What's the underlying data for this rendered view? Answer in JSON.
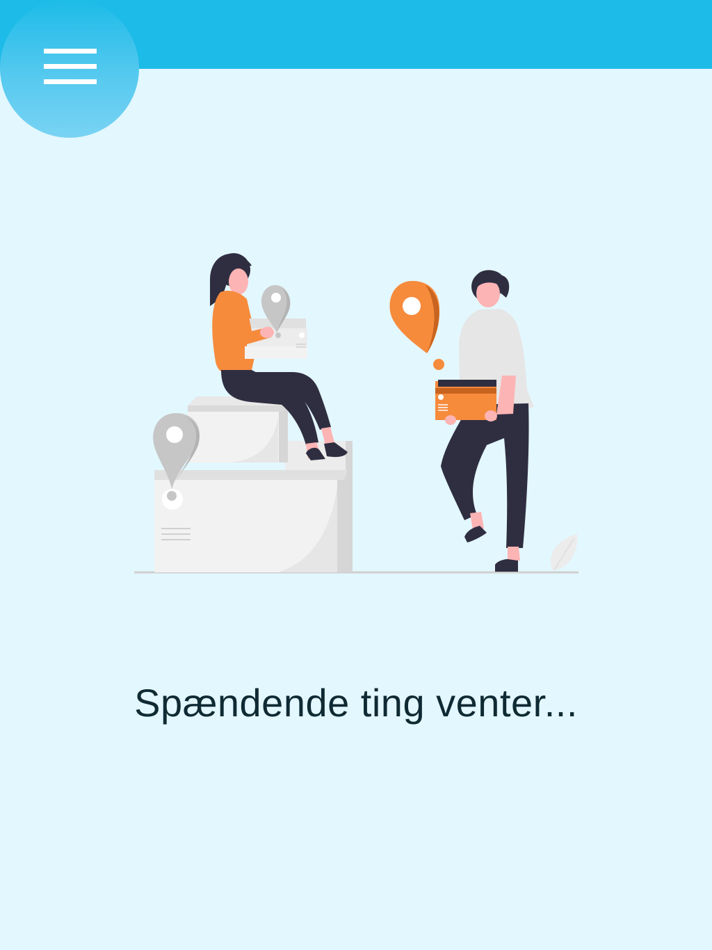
{
  "header": {
    "menu_icon": "hamburger-menu-icon",
    "bar_color": "#1cbbe8"
  },
  "illustration": {
    "description_icon": "delivery-people-illustration",
    "accent_color": "#f68b3c"
  },
  "main": {
    "message": "Spændende ting venter..."
  }
}
